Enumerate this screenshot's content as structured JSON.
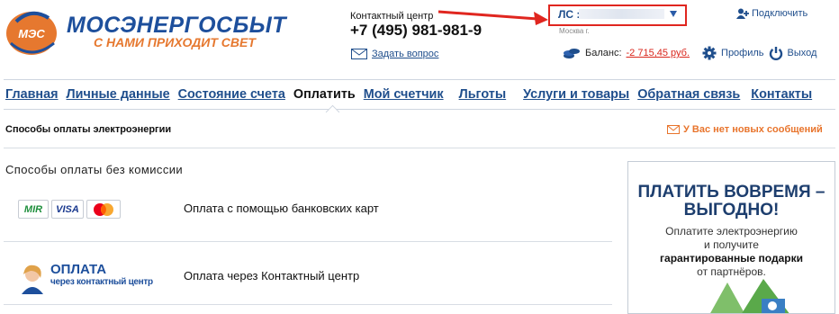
{
  "header": {
    "logo_badge": "МЭС",
    "logo_main": "МОСЭНЕРГОСБЫТ",
    "logo_sub": "С НАМИ ПРИХОДИТ СВЕТ",
    "contact_label": "Контактный центр",
    "contact_phone": "+7 (495) 981-981-9",
    "ask_link": "Задать вопрос",
    "account_label": "ЛС :",
    "account_city": "Москва г.",
    "connect_link": "Подключить",
    "balance_label": "Баланс:",
    "balance_value": "-2 715,45 руб.",
    "profile_link": "Профиль",
    "exit_link": "Выход"
  },
  "nav": {
    "items": [
      {
        "label": "Главная",
        "active": false
      },
      {
        "label": "Личные данные",
        "active": false
      },
      {
        "label": "Состояние счета",
        "active": false
      },
      {
        "label": "Оплатить",
        "active": true
      },
      {
        "label": "Мой счетчик",
        "active": false
      },
      {
        "label": "Льготы",
        "active": false
      },
      {
        "label": "Услуги и товары",
        "active": false
      },
      {
        "label": "Обратная связь",
        "active": false
      },
      {
        "label": "Контакты",
        "active": false
      }
    ]
  },
  "page": {
    "section_title": "Способы оплаты электроэнергии",
    "messages_notice": "У Вас нет новых сообщений",
    "subheading": "Способы оплаты без комиссии",
    "methods": [
      {
        "label": "Оплата с помощью банковских карт",
        "card_logos": [
          "MIR",
          "VISA",
          "mastercard"
        ]
      },
      {
        "label": "Оплата через Контактный центр",
        "logo_title": "ОПЛАТА",
        "logo_sub": "через контактный центр"
      }
    ]
  },
  "banner": {
    "title_line1": "ПЛАТИТЬ ВОВРЕМЯ –",
    "title_line2": "ВЫГОДНО!",
    "text_line1": "Оплатите электроэнергию",
    "text_line2": "и получите",
    "text_bold": "гарантированные подарки",
    "text_line4": "от партнёров."
  },
  "colors": {
    "brand_blue": "#1d4f9c",
    "brand_orange": "#e6782f",
    "link": "#1f4e8c",
    "alert_red": "#e0261f",
    "notice_orange": "#e8742c"
  },
  "icons": [
    "mes-logo-icon",
    "envelope-icon",
    "user-add-icon",
    "coins-icon",
    "gear-icon",
    "power-icon",
    "dropdown-arrow-icon",
    "message-envelope-icon",
    "annotation-arrow-icon"
  ]
}
